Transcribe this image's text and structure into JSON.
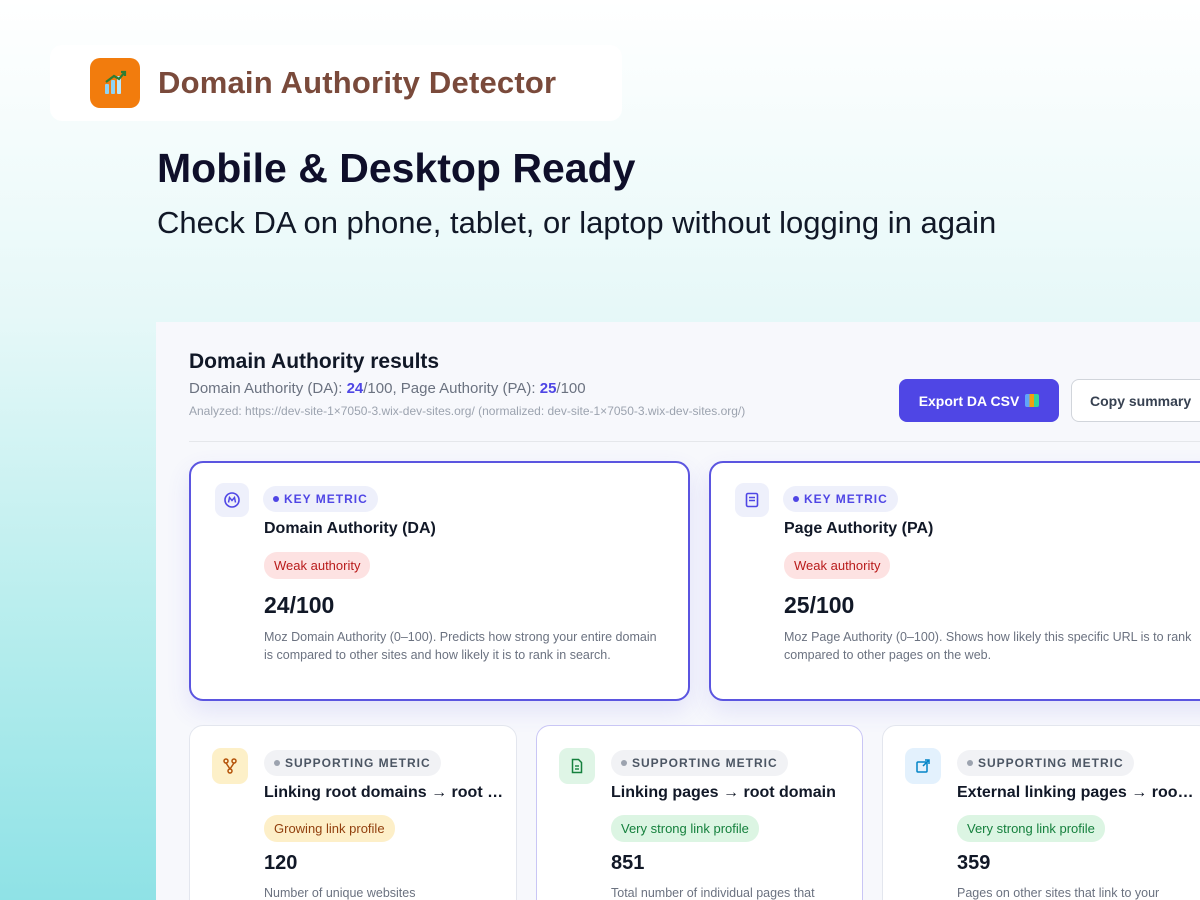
{
  "brand": {
    "name": "Domain Authority Detector",
    "logo_icon": "chart-growth-icon",
    "logo_color": "#f27c0d"
  },
  "hero": {
    "headline": "Mobile & Desktop Ready",
    "subhead": "Check DA on phone, tablet, or laptop without logging in again"
  },
  "results": {
    "title": "Domain Authority results",
    "summary_prefix_da": "Domain Authority (DA): ",
    "da_value": "24",
    "summary_mid": "/100, Page Authority (PA): ",
    "pa_value": "25",
    "summary_suffix": "/100",
    "analyzed": "Analyzed: https://dev-site-1×7050-3.wix-dev-sites.org/ (normalized: dev-site-1×7050-3.wix-dev-sites.org/)",
    "export_label": "Export DA CSV",
    "copy_label": "Copy summary"
  },
  "key_cards": [
    {
      "tag": "KEY METRIC",
      "title": "Domain Authority (DA)",
      "badge": "Weak authority",
      "value": "24/100",
      "desc": "Moz Domain Authority (0–100). Predicts how strong your entire domain is compared to other sites and how likely it is to rank in search.",
      "icon": "moz-icon"
    },
    {
      "tag": "KEY METRIC",
      "title": "Page Authority (PA)",
      "badge": "Weak authority",
      "value": "25/100",
      "desc": "Moz Page Authority (0–100). Shows how likely this specific URL is to rank compared to other pages on the web.",
      "icon": "page-icon"
    }
  ],
  "support_cards": [
    {
      "tag": "SUPPORTING METRIC",
      "title": "Linking root domains → root d...",
      "badge": "Growing link profile",
      "value": "120",
      "desc": "Number of unique websites",
      "icon": "branch-icon"
    },
    {
      "tag": "SUPPORTING METRIC",
      "title": "Linking pages → root domain",
      "badge": "Very strong link profile",
      "value": "851",
      "desc": "Total number of individual pages that",
      "icon": "document-icon"
    },
    {
      "tag": "SUPPORTING METRIC",
      "title": "External linking pages → root ...",
      "badge": "Very strong link profile",
      "value": "359",
      "desc": "Pages on other sites that link to your",
      "icon": "external-link-icon"
    }
  ],
  "colors": {
    "accent": "#4f46e5",
    "weak": "#b91c1c",
    "growing": "#92400e",
    "strong": "#15803d"
  }
}
